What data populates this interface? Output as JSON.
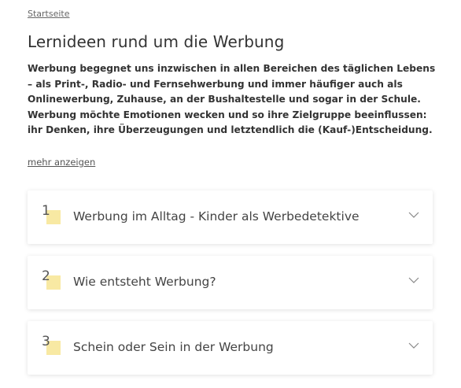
{
  "breadcrumb": {
    "label": "Startseite"
  },
  "page": {
    "title": "Lernideen rund um die Werbung",
    "intro": "Werbung begegnet uns inzwischen in allen Bereichen des täglichen Lebens – als Print-, Radio- und Fernsehwerbung und immer häufiger auch als Onlinewerbung, Zuhause, an der Bushaltestelle und sogar in der Schule. Werbung möchte Emotionen wecken und so ihre Zielgruppe beeinflussen: ihr Denken, ihre Überzeugungen und letztendlich die (Kauf-)Entscheidung.",
    "more_link": "mehr anzeigen"
  },
  "accordions": [
    {
      "number": "1",
      "title": "Werbung im Alltag - Kinder als Werbedetektive",
      "icon": "chevron-down-icon"
    },
    {
      "number": "2",
      "title": "Wie entsteht Werbung?",
      "icon": "chevron-down-icon"
    },
    {
      "number": "3",
      "title": "Schein oder Sein in der Werbung",
      "icon": "chevron-down-icon"
    }
  ],
  "colors": {
    "number_highlight": "#f8e9a3",
    "text": "#333333"
  }
}
